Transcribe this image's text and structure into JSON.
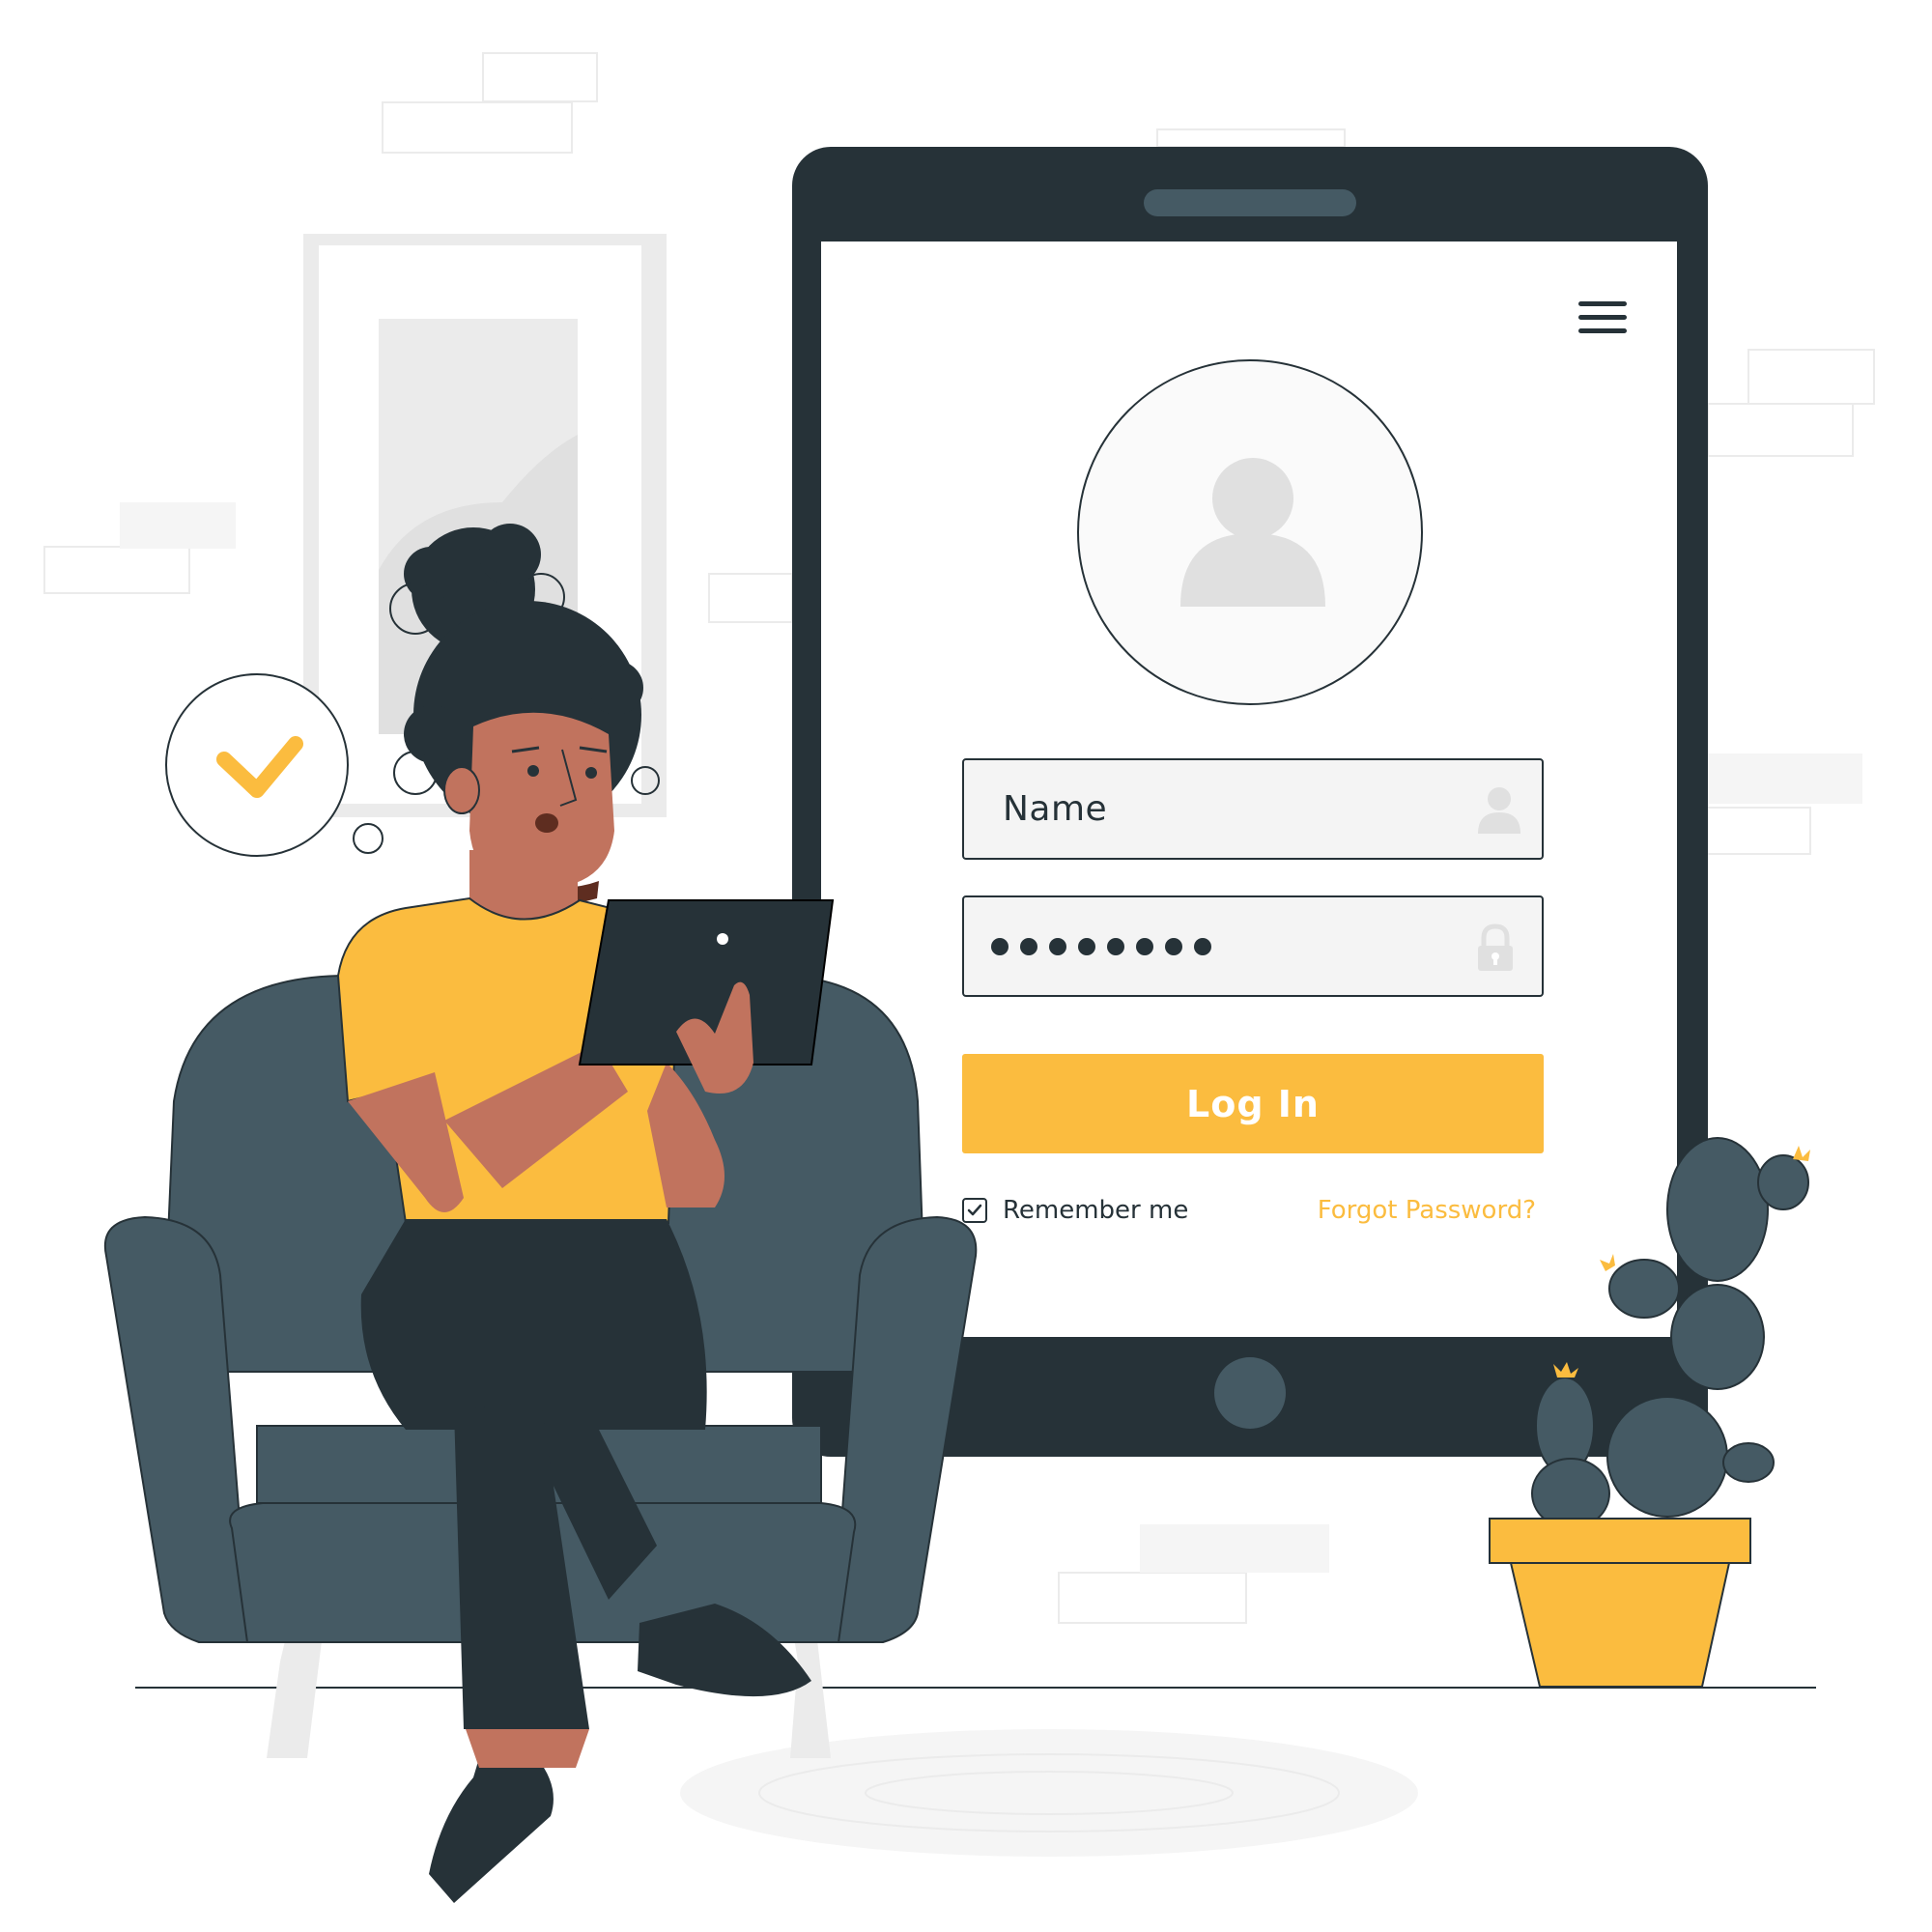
{
  "login_form": {
    "name_field": {
      "value": "Name",
      "icon": "user-icon"
    },
    "password_field": {
      "masked_length": 8,
      "icon": "lock-icon"
    },
    "login_button": {
      "label": "Log In"
    },
    "remember_me": {
      "label": "Remember me",
      "checked": true
    },
    "forgot_password": {
      "label": "Forgot Password?"
    },
    "menu": {
      "icon": "hamburger-menu-icon"
    },
    "avatar": {
      "icon": "user-avatar-icon"
    }
  },
  "colors": {
    "accent": "#fbbc3f",
    "dark": "#263238",
    "chair": "#455a64",
    "skin": "#c1735e",
    "light_gray": "#ebebeb"
  }
}
